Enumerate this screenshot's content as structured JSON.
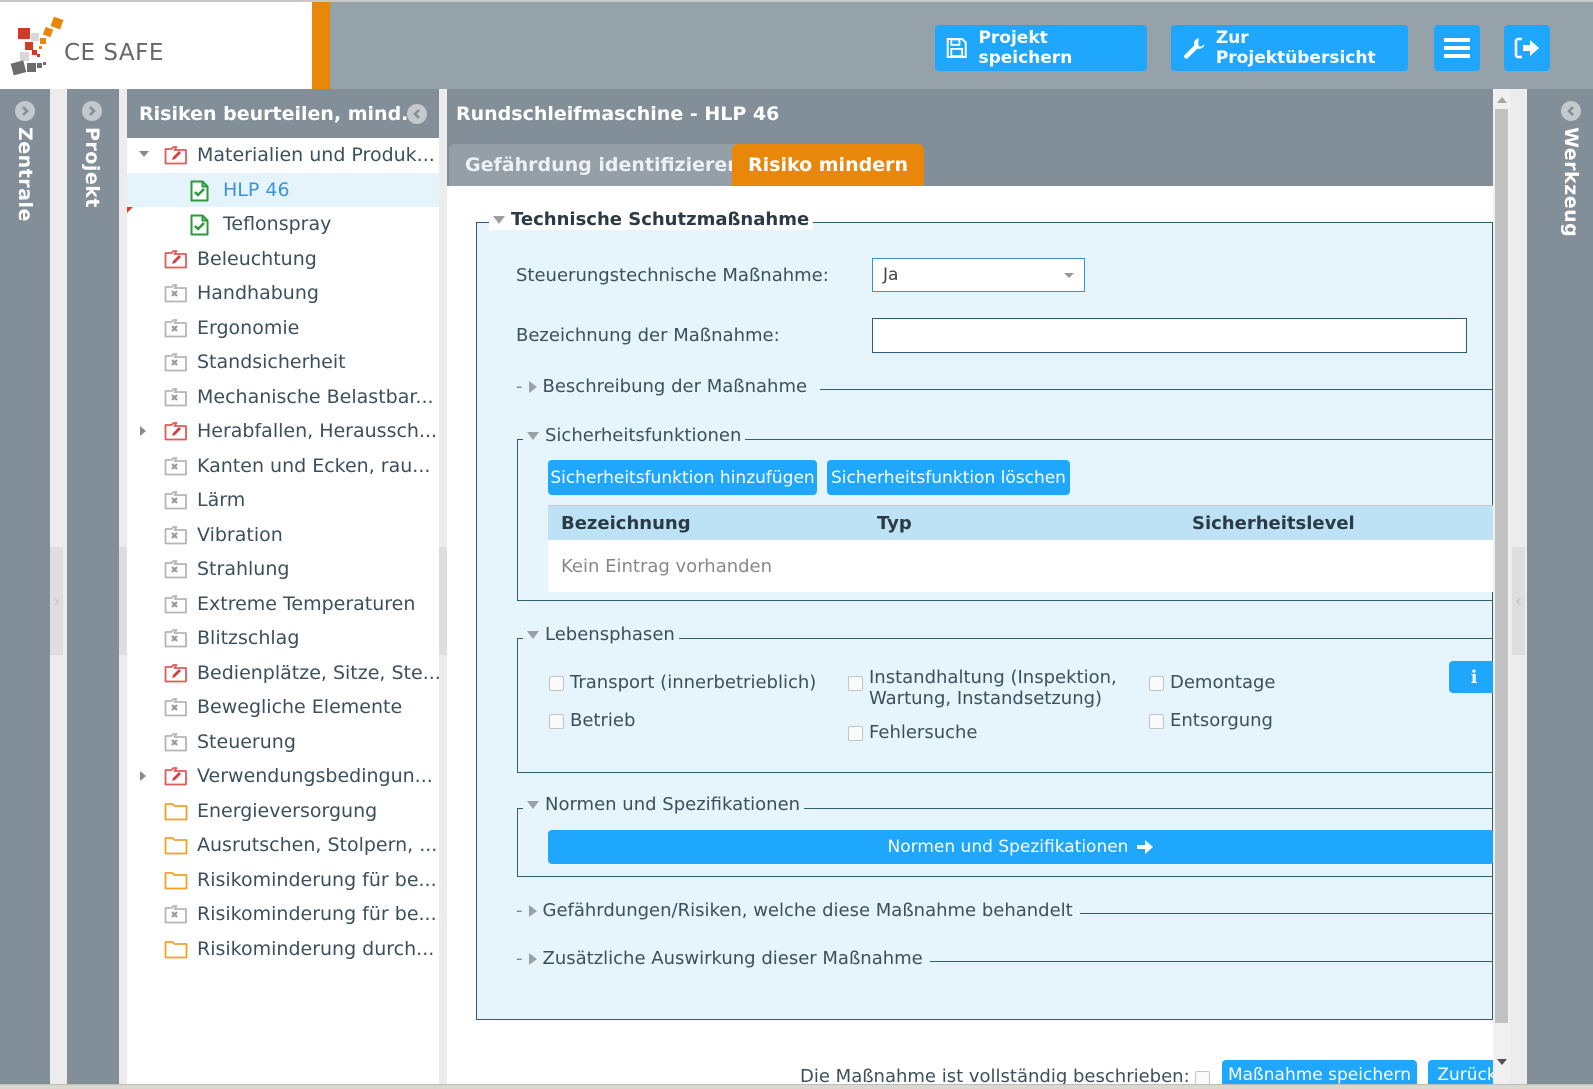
{
  "app": {
    "logo_text": "CE SAFE",
    "accent_color": "#e8870a",
    "button_color": "#1ea7fd"
  },
  "header": {
    "save_project_label": "Projekt speichern",
    "project_overview_label": "Zur Projektübersicht",
    "menu_icon": "hamburger-icon",
    "logout_icon": "logout-icon"
  },
  "rails": {
    "left1": "Zentrale",
    "left2": "Projekt",
    "right": "Werkzeug"
  },
  "tree": {
    "title": "Risiken beurteilen, mind...",
    "items": [
      {
        "label": "Materialien und Produk...",
        "icon": "folder-edit-red",
        "level": 0,
        "toggle": "expanded"
      },
      {
        "label": "HLP 46",
        "icon": "doc-check-green",
        "level": 1,
        "selected": true
      },
      {
        "label": "Teflonspray",
        "icon": "doc-check-green",
        "level": 1,
        "marker": true
      },
      {
        "label": "Beleuchtung",
        "icon": "folder-edit-red",
        "level": 0
      },
      {
        "label": "Handhabung",
        "icon": "folder-x-gray",
        "level": 0
      },
      {
        "label": "Ergonomie",
        "icon": "folder-x-gray",
        "level": 0
      },
      {
        "label": "Standsicherheit",
        "icon": "folder-x-gray",
        "level": 0
      },
      {
        "label": "Mechanische Belastbar...",
        "icon": "folder-x-gray",
        "level": 0
      },
      {
        "label": "Herabfallen, Heraussch...",
        "icon": "folder-edit-red",
        "level": 0,
        "toggle": "collapsed"
      },
      {
        "label": "Kanten und Ecken, rau...",
        "icon": "folder-x-gray",
        "level": 0
      },
      {
        "label": "Lärm",
        "icon": "folder-x-gray",
        "level": 0
      },
      {
        "label": "Vibration",
        "icon": "folder-x-gray",
        "level": 0
      },
      {
        "label": "Strahlung",
        "icon": "folder-x-gray",
        "level": 0
      },
      {
        "label": "Extreme Temperaturen",
        "icon": "folder-x-gray",
        "level": 0
      },
      {
        "label": "Blitzschlag",
        "icon": "folder-x-gray",
        "level": 0
      },
      {
        "label": "Bedienplätze, Sitze, Ste...",
        "icon": "folder-edit-red",
        "level": 0
      },
      {
        "label": "Bewegliche Elemente",
        "icon": "folder-x-gray",
        "level": 0
      },
      {
        "label": "Steuerung",
        "icon": "folder-x-gray",
        "level": 0
      },
      {
        "label": "Verwendungsbedingun...",
        "icon": "folder-edit-red",
        "level": 0,
        "toggle": "collapsed"
      },
      {
        "label": "Energieversorgung",
        "icon": "folder-orange",
        "level": 0
      },
      {
        "label": "Ausrutschen, Stolpern, ...",
        "icon": "folder-orange",
        "level": 0
      },
      {
        "label": "Risikominderung für be...",
        "icon": "folder-orange",
        "level": 0
      },
      {
        "label": "Risikominderung für be...",
        "icon": "folder-x-gray",
        "level": 0
      },
      {
        "label": "Risikominderung durch...",
        "icon": "folder-orange",
        "level": 0
      }
    ]
  },
  "main": {
    "title": "Rundschleifmaschine - HLP 46",
    "tabs": [
      {
        "label": "Gefährdung identifizieren",
        "active": false
      },
      {
        "label": "Risiko mindern",
        "active": true
      }
    ],
    "section_title": "Technische Schutzmaßnahme",
    "fields": {
      "control_measure_label": "Steuerungstechnische Maßnahme:",
      "control_measure_value": "Ja",
      "measure_name_label": "Bezeichnung der Maßnahme:",
      "measure_name_value": ""
    },
    "description_section": "Beschreibung der Maßnahme",
    "safety_functions": {
      "title": "Sicherheitsfunktionen",
      "add_label": "Sicherheitsfunktion hinzufügen",
      "delete_label": "Sicherheitsfunktion löschen",
      "columns": [
        "Bezeichnung",
        "Typ",
        "Sicherheitslevel"
      ],
      "empty_text": "Kein Eintrag vorhanden"
    },
    "life_phases": {
      "title": "Lebensphasen",
      "options": [
        {
          "label": "Transport (innerbetrieblich)",
          "checked": false
        },
        {
          "label": "Instandhaltung (Inspektion, Wartung, Instandsetzung)",
          "label_line1": "Instandhaltung (Inspektion,",
          "label_line2": "Wartung, Instandsetzung)",
          "checked": false
        },
        {
          "label": "Demontage",
          "checked": false
        },
        {
          "label": "Betrieb",
          "checked": false
        },
        {
          "label": "Fehlersuche",
          "checked": false
        },
        {
          "label": "Entsorgung",
          "checked": false
        }
      ],
      "info_label": "i"
    },
    "norms": {
      "title": "Normen und Spezifikationen",
      "button_label": "Normen und Spezifikationen"
    },
    "hazards_section": "Gefährdungen/Risiken, welche diese Maßnahme behandelt",
    "effects_section": "Zusätzliche Auswirkung dieser Maßnahme",
    "footer": {
      "complete_label": "Die Maßnahme ist vollständig beschrieben:",
      "complete_checked": false,
      "save_label": "Maßnahme speichern",
      "back_label": "Zurück"
    }
  }
}
